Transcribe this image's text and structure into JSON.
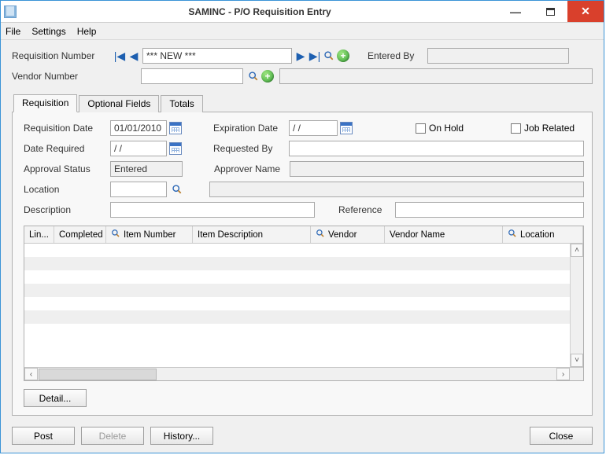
{
  "window_title": "SAMINC - P/O Requisition Entry",
  "menus": {
    "file": "File",
    "settings": "Settings",
    "help": "Help"
  },
  "header": {
    "req_num_label": "Requisition Number",
    "req_num_value": "*** NEW ***",
    "entered_by_label": "Entered By",
    "entered_by_value": "",
    "vendor_number_label": "Vendor Number",
    "vendor_number_value": "",
    "vendor_name_value": ""
  },
  "tabs": {
    "requisition": "Requisition",
    "optional_fields": "Optional Fields",
    "totals": "Totals"
  },
  "panel": {
    "req_date_label": "Requisition Date",
    "req_date_value": "01/01/2010",
    "exp_date_label": "Expiration Date",
    "exp_date_value": "/  /",
    "on_hold_label": "On Hold",
    "job_related_label": "Job Related",
    "date_required_label": "Date Required",
    "date_required_value": "/  /",
    "requested_by_label": "Requested By",
    "requested_by_value": "",
    "approval_status_label": "Approval Status",
    "approval_status_value": "Entered",
    "approver_name_label": "Approver Name",
    "approver_name_value": "",
    "location_label": "Location",
    "location_value": "",
    "location_name_value": "",
    "description_label": "Description",
    "description_value": "",
    "reference_label": "Reference",
    "reference_value": ""
  },
  "grid": {
    "columns": {
      "line": "Lin...",
      "completed": "Completed",
      "item_number": "Item Number",
      "item_description": "Item Description",
      "vendor": "Vendor",
      "vendor_name": "Vendor Name",
      "location": "Location"
    }
  },
  "buttons": {
    "detail": "Detail...",
    "post": "Post",
    "delete": "Delete",
    "history": "History...",
    "close": "Close"
  }
}
